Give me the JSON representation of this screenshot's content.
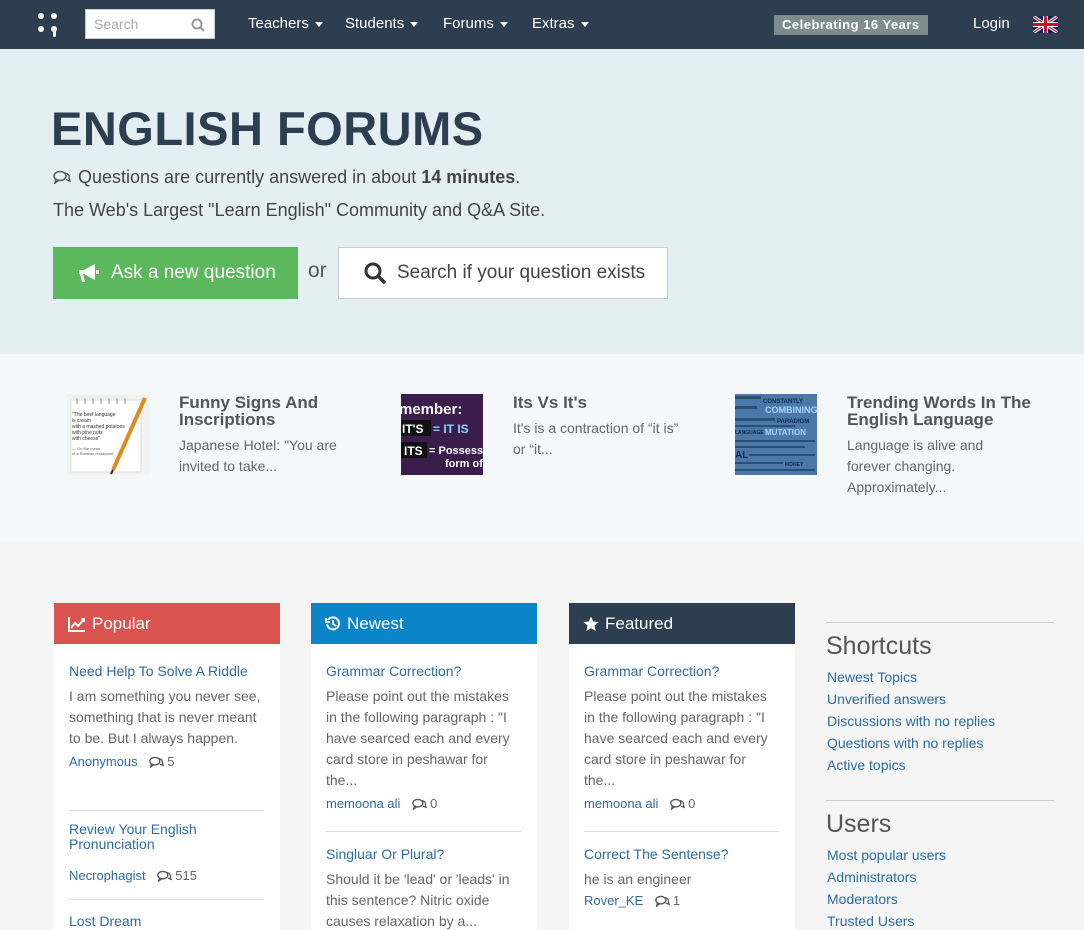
{
  "nav": {
    "search_placeholder": "Search",
    "menu": [
      "Teachers",
      "Students",
      "Forums",
      "Extras"
    ],
    "badge": "Celebrating 16 Years",
    "login": "Login"
  },
  "hero": {
    "title": "ENGLISH FORUMS",
    "answer_prefix": "Questions are currently answered in about",
    "answer_time": "14 minutes",
    "answer_suffix": ".",
    "tagline": "The Web's Largest \"Learn English\" Community and Q&A Site.",
    "ask_button": "Ask a new question",
    "or": "or",
    "search_button": "Search if your question exists"
  },
  "articles": [
    {
      "title": "Funny Signs And Inscriptions",
      "excerpt": "Japanese Hotel: \"You are invited to take...",
      "thumb_text": [
        "\"The beef language",
        "is cream",
        "with a mashed potatoes",
        "with pine nuts",
        "with cheese\"",
        "— On the menu",
        "of a Russian restaurant"
      ]
    },
    {
      "title": "Its Vs It's",
      "excerpt": "It's is a contraction of “it is” or “it...",
      "thumb_text": [
        "member:",
        "IT'S",
        "= IT IS",
        "ITS",
        "= Possess",
        "form of"
      ]
    },
    {
      "title": "Trending Words In The English Language",
      "excerpt": "Language is alive and forever changing. Approximately...",
      "thumb_text": [
        "CONSTANTLY",
        "COMBINING",
        "PARADIGM",
        "LANGUAGE",
        "MUTATION",
        "AL",
        "MONEY"
      ]
    }
  ],
  "panels": [
    {
      "title": "Popular",
      "color": "#d9534f",
      "icon": "chart-line-icon",
      "items": [
        {
          "title": "Need Help To Solve A Riddle",
          "text": "I am something you never see, something that is never meant to be. But I always happen.",
          "author": "Anonymous",
          "count": "5"
        },
        {
          "title": "Review Your English Pronunciation",
          "text": "",
          "author": "Necrophagist",
          "count": "515"
        },
        {
          "title": "Lost Dream",
          "text": "",
          "author": "",
          "count": ""
        }
      ]
    },
    {
      "title": "Newest",
      "color": "#0a85c9",
      "icon": "history-icon",
      "items": [
        {
          "title": "Grammar Correction?",
          "text": "Please point out the mistakes in the following paragraph : \"I have searced each and every card store in peshawar for the...",
          "author": "memoona ali",
          "count": "0"
        },
        {
          "title": "Singluar Or Plural?",
          "text": "Should it be 'lead' or 'leads' in this sentence? Nitric oxide causes relaxation by a...",
          "author": "",
          "count": ""
        }
      ]
    },
    {
      "title": "Featured",
      "color": "#2c3e50",
      "icon": "star-icon",
      "items": [
        {
          "title": "Grammar Correction?",
          "text": "Please point out the mistakes in the following paragraph : \"I have searced each and every card store in peshawar for the...",
          "author": "memoona ali",
          "count": "0"
        },
        {
          "title": "Correct The Sentense?",
          "text": "he is an engineer",
          "author": "Rover_KE",
          "count": "1"
        }
      ]
    }
  ],
  "sidebar": {
    "shortcuts_title": "Shortcuts",
    "shortcuts": [
      "Newest Topics",
      "Unverified answers",
      "Discussions with no replies",
      "Questions with no replies",
      "Active topics"
    ],
    "users_title": "Users",
    "users": [
      "Most popular users",
      "Administrators",
      "Moderators",
      "Trusted Users"
    ]
  }
}
